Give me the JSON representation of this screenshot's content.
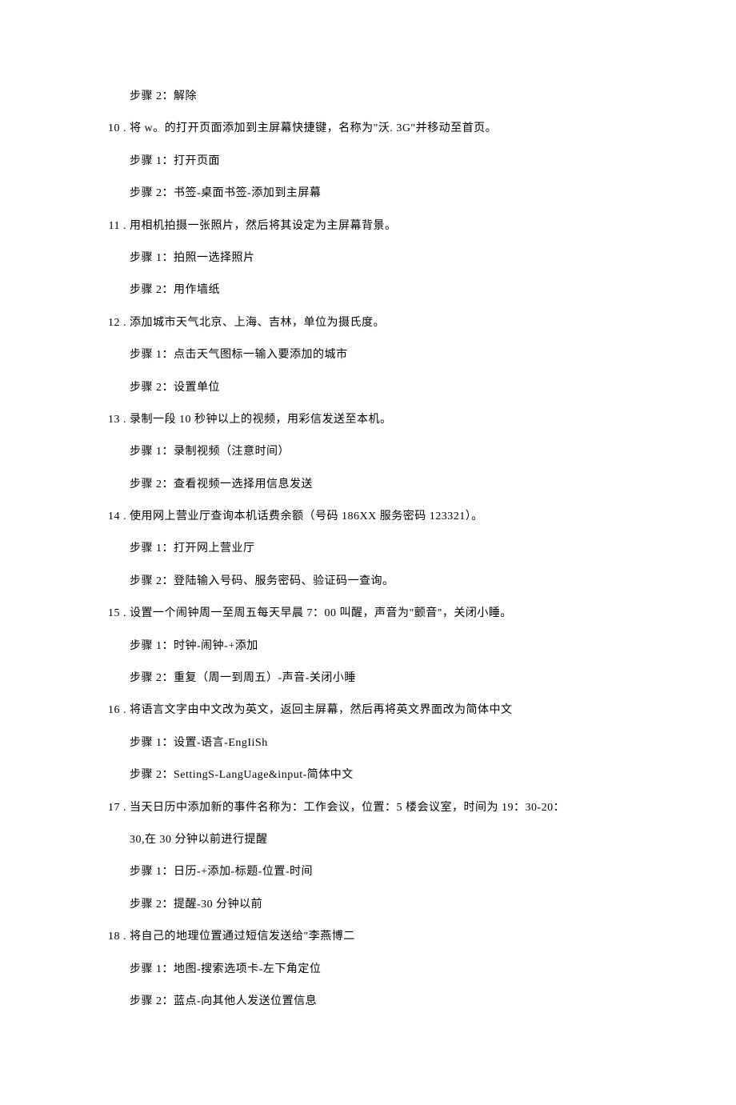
{
  "lines": [
    {
      "type": "step",
      "text": "步骤 2：解除"
    },
    {
      "type": "item",
      "num": "10 .",
      "text": "将 w。的打开页面添加到主屏幕快捷键，名称为\"沃. 3G\"并移动至首页。"
    },
    {
      "type": "step",
      "text": "步骤 1：打开页面"
    },
    {
      "type": "step",
      "text": "步骤 2：书签-桌面书签-添加到主屏幕"
    },
    {
      "type": "item",
      "num": "11 .",
      "text": "用相机拍摄一张照片，然后将其设定为主屏幕背景。"
    },
    {
      "type": "step",
      "text": "步骤 1：拍照一选择照片"
    },
    {
      "type": "step",
      "text": "步骤 2：用作墙纸"
    },
    {
      "type": "item",
      "num": "12 .",
      "text": "添加城市天气北京、上海、吉林，单位为摄氏度。"
    },
    {
      "type": "step",
      "text": "步骤 1：点击天气图标一输入要添加的城市"
    },
    {
      "type": "step",
      "text": "步骤 2：设置单位"
    },
    {
      "type": "item",
      "num": "13 .",
      "text": "录制一段 10 秒钟以上的视频，用彩信发送至本机。"
    },
    {
      "type": "step",
      "text": "步骤 1：录制视频（注意时间）"
    },
    {
      "type": "step",
      "text": "步骤 2：查看视频一选择用信息发送"
    },
    {
      "type": "item",
      "num": "14 .",
      "text": "使用网上营业厅查询本机话费余额（号码 186XX 服务密码 123321）。"
    },
    {
      "type": "step",
      "text": "步骤 1：打开网上营业厅"
    },
    {
      "type": "step",
      "text": "步骤 2：登陆输入号码、服务密码、验证码一查询。"
    },
    {
      "type": "item",
      "num": "15 .",
      "text": "设置一个闹钟周一至周五每天早晨 7：00 叫醒，声音为\"颤音\"，关闭小睡。"
    },
    {
      "type": "step",
      "text": "步骤 1：时钟-闹钟-+添加"
    },
    {
      "type": "step",
      "text": "步骤 2：重复（周一到周五）-声音-关闭小睡"
    },
    {
      "type": "item",
      "num": "16 .",
      "text": "将语言文字由中文改为英文，返回主屏幕，然后再将英文界面改为简体中文"
    },
    {
      "type": "step",
      "text": "步骤 1：设置-语言-EngIiSh"
    },
    {
      "type": "step",
      "text": "步骤 2：SettingS-LangUage&input-简体中文"
    },
    {
      "type": "item",
      "num": "17 .",
      "text": "当天日历中添加新的事件名称为：工作会议，位置：5 楼会议室，时间为 19：30-20："
    },
    {
      "type": "cont",
      "text": "30,在 30 分钟以前进行提醒"
    },
    {
      "type": "step",
      "text": "步骤 1：日历-+添加-标题-位置-时间"
    },
    {
      "type": "step",
      "text": "步骤 2：提醒-30 分钟以前"
    },
    {
      "type": "item",
      "num": "18 .",
      "text": "将自己的地理位置通过短信发送给\"李燕博二"
    },
    {
      "type": "step",
      "text": "步骤 1：地图-搜索选项卡-左下角定位"
    },
    {
      "type": "step",
      "text": "步骤 2：蓝点-向其他人发送位置信息"
    }
  ]
}
